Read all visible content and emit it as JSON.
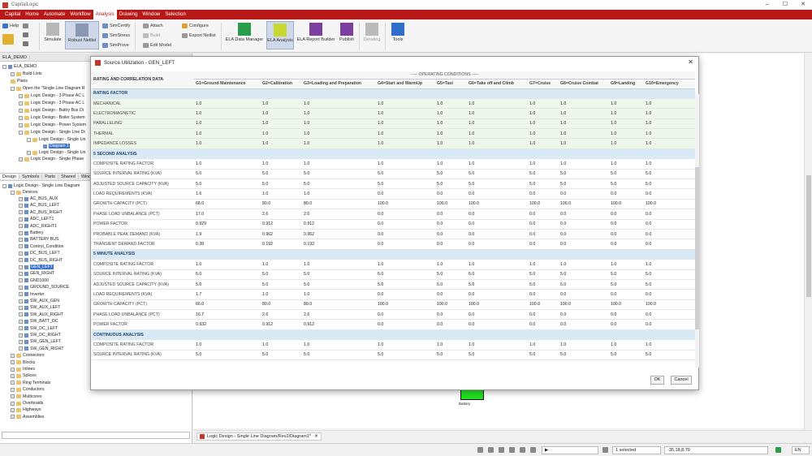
{
  "app": {
    "title": "CapitalLogic",
    "window_controls": [
      "–",
      "☐",
      "✕"
    ]
  },
  "menu": [
    "Capital",
    "Home",
    "Automate",
    "Workflow",
    "Analysis",
    "Drawing",
    "Window",
    "Selection"
  ],
  "menu_active": "Analysis",
  "ribbon": {
    "help": "Help",
    "simulate": "Simulate",
    "robust_netlist": "Robust Netlist",
    "simcertify": "SimCertify",
    "simstress": "SimStress",
    "simprove": "SimProve",
    "attach": "Attach",
    "build": "Build",
    "edit_model": "Edit Model",
    "configure": "Configure",
    "export_netlist": "Export Netlist",
    "ela_data_manager": "ELA Data Manager",
    "ela_analysis": "ELA Analysis",
    "ela_report_builder": "ELA Report Builder",
    "publish": "Publish",
    "derating": "Derating",
    "tools": "Tools"
  },
  "project_tree": [
    "ELA_DEMO",
    "Build Lists",
    "Plans",
    "Open the \"Single Line Diagram R",
    "Logic Design - 3 Phase AC L",
    "Logic Design - 3 Phase AC L",
    "Logic Design - Battry Bus Di",
    "Logic Design - Boiler System",
    "Logic Design - Power System",
    "Logic Design - Single Line Di",
    "Logic Design - Single Lin",
    "Diagram 1",
    "Logic Design - Single Lin",
    "Logic Design - Single Phase"
  ],
  "panel_tabs": [
    "Design",
    "Symbols",
    "Parts",
    "Shared",
    "Wind"
  ],
  "design_tree": {
    "root": "Logic Design - Single Line Diagram",
    "devices_label": "Devices",
    "devices": [
      "AC_BUS_AUX",
      "AC_BUS_LEFT",
      "AC_BUS_RIGHT",
      "ADC_LEFT1",
      "ADC_RIGHT1",
      "Battery",
      "BATTERY BUS",
      "Control_Condition",
      "DC_BUS_LEFT",
      "DC_BUS_RIGHT",
      "GEN_LEFT",
      "GEN_RIGHT",
      "GND1000",
      "GROUND_SOURCE",
      "Inverter",
      "SW_AUX_GEN",
      "SW_AUX_LEFT",
      "SW_AUX_RIGHT",
      "SW_BATT_DC",
      "SW_DC_LEFT",
      "SW_DC_RIGHT",
      "SW_GEN_LEFT",
      "SW_GEN_RIGHT"
    ],
    "selected": "GEN_LEFT",
    "folders": [
      "Connectors",
      "Blocks",
      "Inlines",
      "Splices",
      "Ring Terminals",
      "Conductors",
      "Multicores",
      "Overbraids",
      "Highways",
      "Assemblies"
    ]
  },
  "canvas": {
    "battery_label": "Battery"
  },
  "document_tab": "Logic Design - Single Line Diagram/Rev2/Diagram1*",
  "status": {
    "selected": "1 selected",
    "coords": "-35.18,8.79",
    "lang": "EN"
  },
  "dialog": {
    "title": "Source Utilization - GEN_LEFT",
    "header_left": "RATING AND CORRELATION DATA",
    "header_group": "----- OPERATING CONDITIONS -----",
    "columns": [
      "G1=Ground Maintenance",
      "G2=Calibration",
      "G3=Loading and Preparation",
      "G4=Start and WarmUp",
      "G5=Taxi",
      "G6=Take off and Climb",
      "G7=Cruise",
      "G8=Cruise Combat",
      "G9=Landing",
      "G10=Emergency"
    ],
    "rows": [
      {
        "type": "section",
        "label": "RATING FACTOR"
      },
      {
        "type": "green",
        "label": "MECHANICAL",
        "values": [
          "1.0",
          "1.0",
          "1.0",
          "1.0",
          "1.0",
          "1.0",
          "1.0",
          "1.0",
          "1.0",
          "1.0"
        ]
      },
      {
        "type": "green",
        "label": "ELECTROMAGNETIC",
        "values": [
          "1.0",
          "1.0",
          "1.0",
          "1.0",
          "1.0",
          "1.0",
          "1.0",
          "1.0",
          "1.0",
          "1.0"
        ]
      },
      {
        "type": "green",
        "label": "PARALLELING",
        "values": [
          "1.0",
          "1.0",
          "1.0",
          "1.0",
          "1.0",
          "1.0",
          "1.0",
          "1.0",
          "1.0",
          "1.0"
        ]
      },
      {
        "type": "green",
        "label": "THERMAL",
        "values": [
          "1.0",
          "1.0",
          "1.0",
          "1.0",
          "1.0",
          "1.0",
          "1.0",
          "1.0",
          "1.0",
          "1.0"
        ]
      },
      {
        "type": "green",
        "label": "IMPEDANCE LOSSES",
        "values": [
          "1.0",
          "1.0",
          "1.0",
          "1.0",
          "1.0",
          "1.0",
          "1.0",
          "1.0",
          "1.0",
          "1.0"
        ]
      },
      {
        "type": "section",
        "label": "5 SECOND ANALYSIS"
      },
      {
        "type": "data",
        "label": "COMPOSITE RATING FACTOR",
        "values": [
          "1.0",
          "1.0",
          "1.0",
          "1.0",
          "1.0",
          "1.0",
          "1.0",
          "1.0",
          "1.0",
          "1.0"
        ]
      },
      {
        "type": "data",
        "label": "SOURCE INTERVAL RATING (KVA)",
        "values": [
          "5.0",
          "5.0",
          "5.0",
          "5.0",
          "5.0",
          "5.0",
          "5.0",
          "5.0",
          "5.0",
          "5.0"
        ]
      },
      {
        "type": "data",
        "label": "ADJUSTED SOURCE CAPACITY (KVA)",
        "values": [
          "5.0",
          "5.0",
          "5.0",
          "5.0",
          "5.0",
          "5.0",
          "5.0",
          "5.0",
          "5.0",
          "5.0"
        ]
      },
      {
        "type": "data",
        "label": "LOAD REQUIREMENTS (KVA)",
        "values": [
          "1.6",
          "1.0",
          "1.0",
          "0.0",
          "0.0",
          "0.0",
          "0.0",
          "0.0",
          "0.0",
          "0.0"
        ]
      },
      {
        "type": "data",
        "label": "GROWTH CAPACITY (PCT)",
        "values": [
          "68.0",
          "80.0",
          "80.0",
          "100.0",
          "100.0",
          "100.0",
          "100.0",
          "100.0",
          "100.0",
          "100.0"
        ]
      },
      {
        "type": "data",
        "label": "PHASE LOAD UNBALANCE (PCT)",
        "values": [
          "17.0",
          "2.6",
          "2.6",
          "0.0",
          "0.0",
          "0.0",
          "0.0",
          "0.0",
          "0.0",
          "0.0"
        ]
      },
      {
        "type": "data",
        "label": "POWER FACTOR",
        "values": [
          "0.929",
          "0.912",
          "0.912",
          "0.0",
          "0.0",
          "0.0",
          "0.0",
          "0.0",
          "0.0",
          "0.0"
        ]
      },
      {
        "type": "data",
        "label": "PROBABLE PEAK DEMAND (KVA)",
        "values": [
          "1.9",
          "0.962",
          "0.962",
          "0.0",
          "0.0",
          "0.0",
          "0.0",
          "0.0",
          "0.0",
          "0.0"
        ]
      },
      {
        "type": "data",
        "label": "TRANSIENT DEMAND FACTOR",
        "values": [
          "0.38",
          "0.192",
          "0.192",
          "0.0",
          "0.0",
          "0.0",
          "0.0",
          "0.0",
          "0.0",
          "0.0"
        ]
      },
      {
        "type": "section",
        "label": "5 MINUTE ANALYSIS"
      },
      {
        "type": "data",
        "label": "COMPOSITE RATING FACTOR",
        "values": [
          "1.0",
          "1.0",
          "1.0",
          "1.0",
          "1.0",
          "1.0",
          "1.0",
          "1.0",
          "1.0",
          "1.0"
        ]
      },
      {
        "type": "data",
        "label": "SOURCE INTERVAL RATING (KVA)",
        "values": [
          "5.0",
          "5.0",
          "5.0",
          "5.0",
          "5.0",
          "5.0",
          "5.0",
          "5.0",
          "5.0",
          "5.0"
        ]
      },
      {
        "type": "data",
        "label": "ADJUSTED SOURCE CAPACITY (KVA)",
        "values": [
          "5.0",
          "5.0",
          "5.0",
          "5.0",
          "5.0",
          "5.0",
          "5.0",
          "5.0",
          "5.0",
          "5.0"
        ]
      },
      {
        "type": "data",
        "label": "LOAD REQUIREMENTS (KVA)",
        "values": [
          "1.7",
          "1.0",
          "1.0",
          "0.0",
          "0.0",
          "0.0",
          "0.0",
          "0.0",
          "0.0",
          "0.0"
        ]
      },
      {
        "type": "data",
        "label": "GROWTH CAPACITY (PCT)",
        "values": [
          "66.0",
          "80.0",
          "80.0",
          "100.0",
          "100.0",
          "100.0",
          "100.0",
          "100.0",
          "100.0",
          "100.0"
        ]
      },
      {
        "type": "data",
        "label": "PHASE LOAD UNBALANCE (PCT)",
        "values": [
          "16.7",
          "2.6",
          "2.6",
          "0.0",
          "0.0",
          "0.0",
          "0.0",
          "0.0",
          "0.0",
          "0.0"
        ]
      },
      {
        "type": "data",
        "label": "POWER FACTOR",
        "values": [
          "0.932",
          "0.912",
          "0.912",
          "0.0",
          "0.0",
          "0.0",
          "0.0",
          "0.0",
          "0.0",
          "0.0"
        ]
      },
      {
        "type": "section",
        "label": "CONTINUOUS ANALYSIS"
      },
      {
        "type": "data",
        "label": "COMPOSITE RATING FACTOR",
        "values": [
          "1.0",
          "1.0",
          "1.0",
          "1.0",
          "1.0",
          "1.0",
          "1.0",
          "1.0",
          "1.0",
          "1.0"
        ]
      },
      {
        "type": "data",
        "label": "SOURCE INTERVAL RATING (KVA)",
        "values": [
          "5.0",
          "5.0",
          "5.0",
          "5.0",
          "5.0",
          "5.0",
          "5.0",
          "5.0",
          "5.0",
          "5.0"
        ]
      }
    ],
    "ok_label": "OK",
    "cancel_label": "Cancel"
  }
}
